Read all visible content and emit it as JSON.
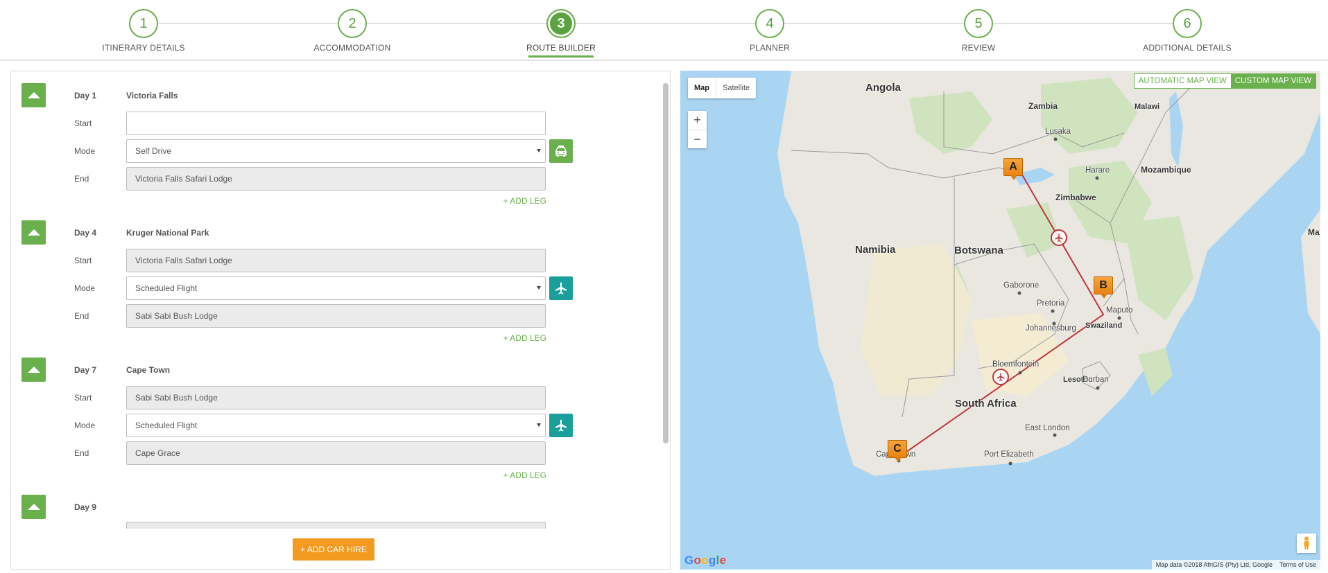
{
  "steps": [
    {
      "number": "1",
      "label": "ITINERARY DETAILS"
    },
    {
      "number": "2",
      "label": "ACCOMMODATION"
    },
    {
      "number": "3",
      "label": "ROUTE BUILDER"
    },
    {
      "number": "4",
      "label": "PLANNER"
    },
    {
      "number": "5",
      "label": "REVIEW"
    },
    {
      "number": "6",
      "label": "ADDITIONAL DETAILS"
    }
  ],
  "active_step": "3",
  "labels": {
    "start": "Start",
    "mode": "Mode",
    "end": "End",
    "add_leg": "+ ADD LEG"
  },
  "days": [
    {
      "day": "Day 1",
      "destination": "Victoria Falls",
      "start": "",
      "mode": "Self Drive",
      "mode_icon": "car-icon",
      "end": "Victoria Falls Safari Lodge"
    },
    {
      "day": "Day 4",
      "destination": "Kruger National Park",
      "start": "Victoria Falls Safari Lodge",
      "mode": "Scheduled Flight",
      "mode_icon": "plane-icon",
      "end": "Sabi Sabi Bush Lodge"
    },
    {
      "day": "Day 7",
      "destination": "Cape Town",
      "start": "Sabi Sabi Bush Lodge",
      "mode": "Scheduled Flight",
      "mode_icon": "plane-icon",
      "end": "Cape Grace"
    },
    {
      "day": "Day 9",
      "destination": ""
    }
  ],
  "add_car_hire_label": "+ ADD CAR HIRE",
  "map": {
    "type_map": "Map",
    "type_satellite": "Satellite",
    "zoom_in": "+",
    "zoom_out": "−",
    "automatic_view": "AUTOMATIC MAP VIEW",
    "custom_view": "CUSTOM MAP VIEW",
    "markers": [
      "A",
      "B",
      "C"
    ],
    "countries": [
      "Angola",
      "Zambia",
      "Malawi",
      "Mozambique",
      "Zimbabwe",
      "Namibia",
      "Botswana",
      "South Africa",
      "Swaziland",
      "Lesotho",
      "Ma"
    ],
    "cities": [
      "Lusaka",
      "Harare",
      "Gaborone",
      "Pretoria",
      "Johannesburg",
      "Maputo",
      "Bloemfontein",
      "Durban",
      "East London",
      "Port Elizabeth",
      "Cape Town"
    ],
    "footer_data": "Map data ©2018 AfriGIS (Pty) Ltd, Google",
    "footer_terms": "Terms of Use",
    "google_logo": "Google",
    "route_color": "#c0353d"
  },
  "colors": {
    "accent_green": "#6ab04c",
    "teal": "#1a9f9a",
    "orange": "#f39b21"
  }
}
